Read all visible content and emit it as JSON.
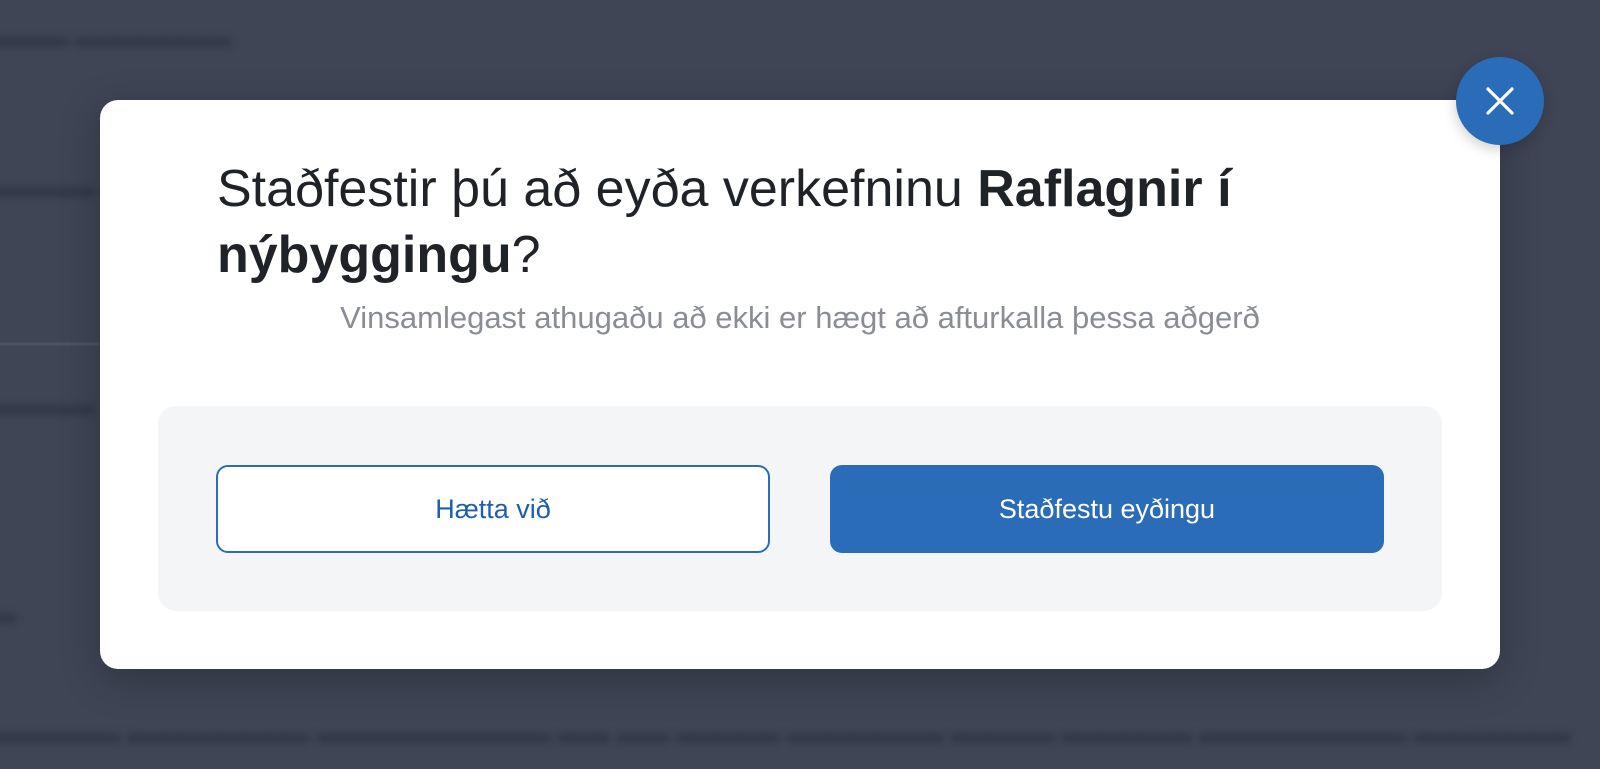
{
  "dialog": {
    "title_prefix": "Staðfestir þú að eyða verkefninu ",
    "project_name": "Raflagnir í nýbyggingu",
    "title_suffix": "?",
    "warning": "Vinsamlegast athugaðu að ekki er hægt að afturkalla þessa aðgerð",
    "cancel_label": "Hætta við",
    "confirm_label": "Staðfestu eyðingu",
    "close_icon": "close-icon"
  },
  "colors": {
    "overlay": "#3f4555",
    "accent": "#2a6cb8",
    "title_text": "#1f2328",
    "muted_text": "#8a8d93",
    "actions_bg": "#f4f5f7"
  }
}
